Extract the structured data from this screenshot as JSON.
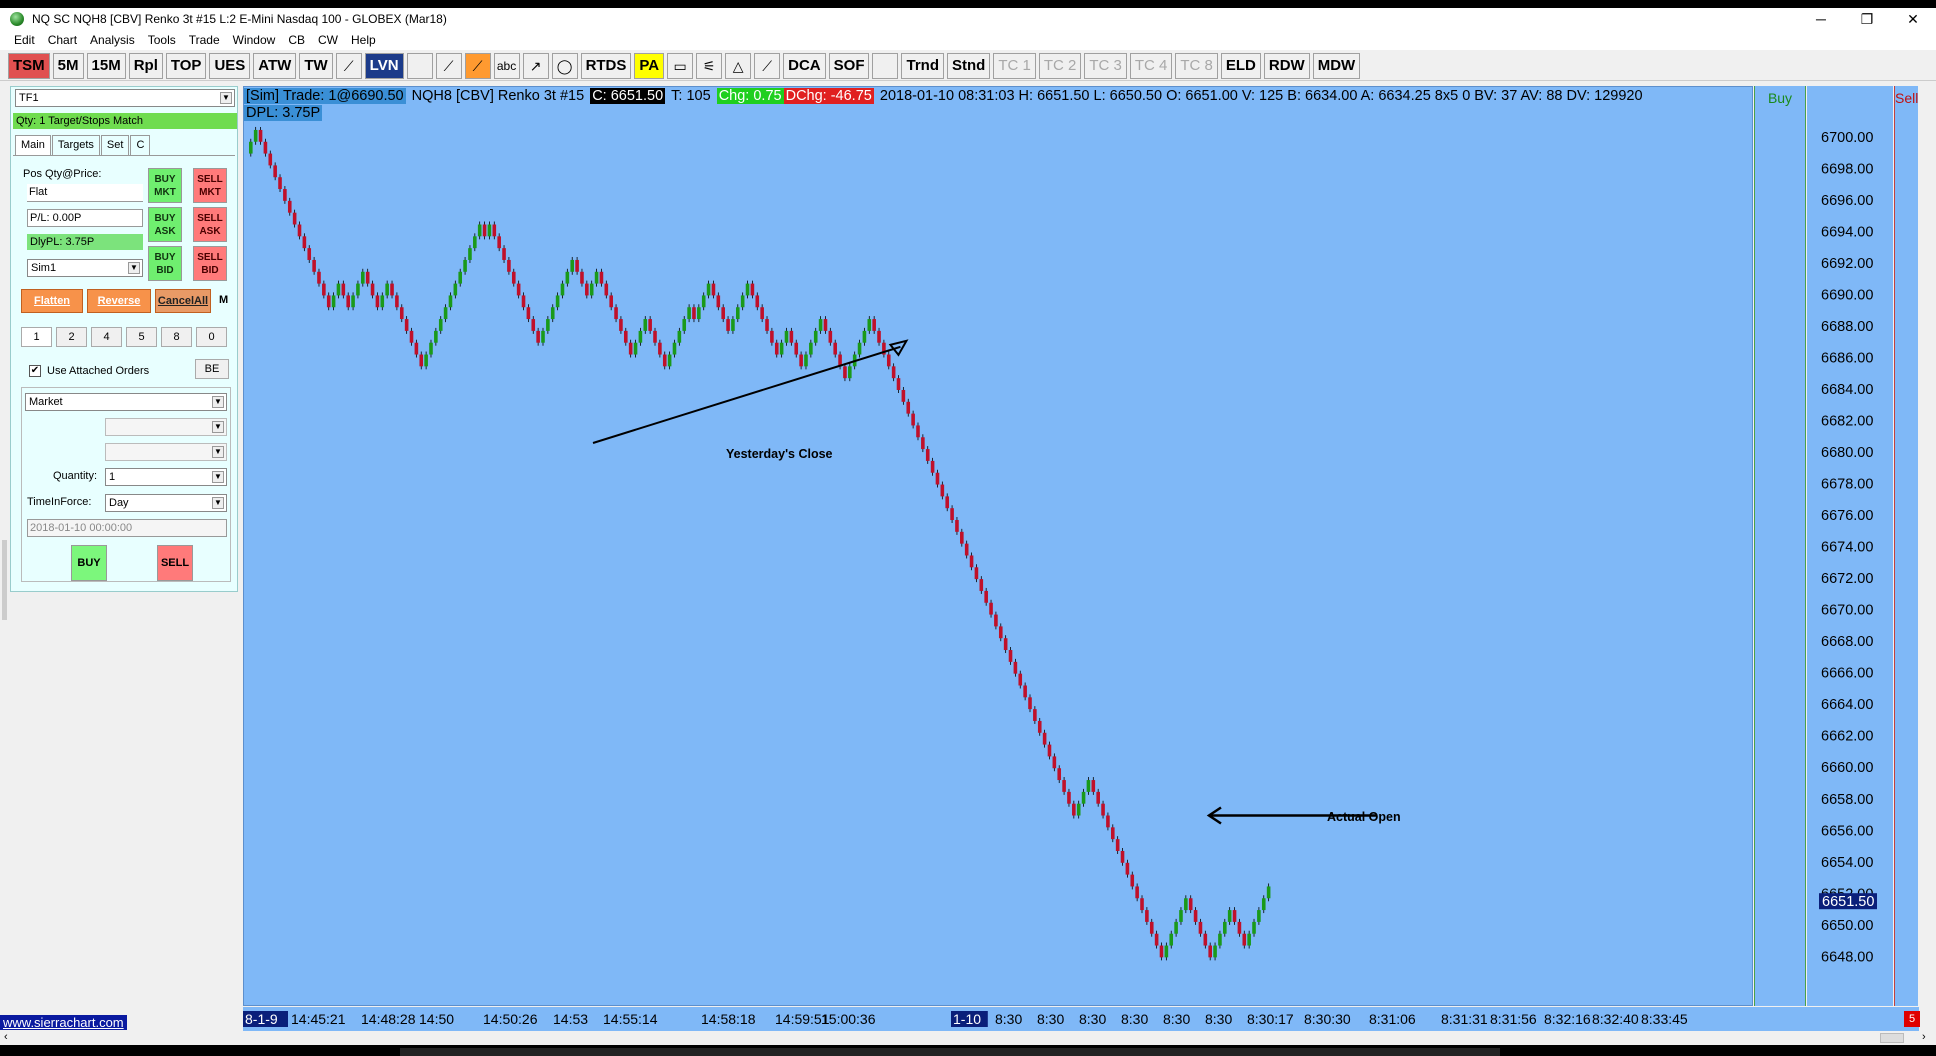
{
  "window": {
    "title": "NQ  SC NQH8 [CBV]  Renko 3t  #15  L:2  E-Mini Nasdaq 100 - GLOBEX (Mar18)",
    "minimize": "─",
    "maximize": "❐",
    "close": "✕"
  },
  "menu": [
    "Edit",
    "Chart",
    "Analysis",
    "Tools",
    "Trade",
    "Window",
    "CB",
    "CW",
    "Help"
  ],
  "toolbar": {
    "tsm": "TSM",
    "m5": "5M",
    "m15": "15M",
    "rpl": "Rpl",
    "top": "TOP",
    "ues": "UES",
    "atw": "ATW",
    "tw": "TW",
    "lvn": "LVN",
    "abc": "abc",
    "rtds": "RTDS",
    "pa": "PA",
    "dca": "DCA",
    "sof": "SOF",
    "trnd": "Trnd",
    "stnd": "Stnd",
    "tc1": "TC 1",
    "tc2": "TC 2",
    "tc3": "TC 3",
    "tc4": "TC 4",
    "tc8": "TC 8",
    "eld": "ELD",
    "rdw": "RDW",
    "mdw": "MDW"
  },
  "trade_panel": {
    "account_select": "TF1",
    "qty_status": "Qty: 1 Target/Stops Match",
    "tabs": [
      "Main",
      "Targets",
      "Set",
      "C"
    ],
    "pos_label": "Pos Qty@Price:",
    "pos_value": "Flat",
    "pl_value": "P/L: 0.00P",
    "dlypl_value": "DlyPL: 3.75P",
    "sim_select": "Sim1",
    "buy_mkt": [
      "BUY",
      "MKT"
    ],
    "sell_mkt": [
      "SELL",
      "MKT"
    ],
    "buy_ask": [
      "BUY",
      "ASK"
    ],
    "sell_ask": [
      "SELL",
      "ASK"
    ],
    "buy_bid": [
      "BUY",
      "BID"
    ],
    "sell_bid": [
      "SELL",
      "BID"
    ],
    "flatten": "Flatten",
    "reverse": "Reverse",
    "cancel_all": "CancelAll",
    "m": "M",
    "quick_qty": [
      "1",
      "2",
      "4",
      "5",
      "8",
      "0"
    ],
    "use_attached": "Use Attached Orders",
    "be": "BE",
    "order_type": "Market",
    "quantity_label": "Quantity:",
    "quantity_value": "1",
    "tif_label": "TimeInForce:",
    "tif_value": "Day",
    "date_value": "2018-01-10  00:00:00",
    "buy": "BUY",
    "sell": "SELL"
  },
  "chart_header": {
    "sim": "[Sim]",
    "trade": "Trade: 1@6690.50",
    "symbol": "NQH8 [CBV]   Renko 3t   #15",
    "close": "C: 6651.50",
    "ticks": "T: 105",
    "chg": "Chg: 0.75",
    "dchg": "DChg: -46.75",
    "stats": "2018-01-10 08:31:03  H: 6651.50  L: 6650.50  O: 6651.00  V: 125  B: 6634.00  A: 6634.25  8x5  0  BV: 37  AV: 88  DV: 129920",
    "dpl": "DPL: 3.75P",
    "buy_col": "Buy",
    "sell_col": "Sell"
  },
  "colors": {
    "chart_bg": "#7fb8f7",
    "up_bar": "#1a9a1a",
    "down_bar": "#c0102a",
    "price_box": "#0a1f7a"
  },
  "chart_data": {
    "type": "renko",
    "brick_size": 0.75,
    "y_ticks": [
      "6700.00",
      "6698.00",
      "6696.00",
      "6694.00",
      "6692.00",
      "6690.00",
      "6688.00",
      "6686.00",
      "6684.00",
      "6682.00",
      "6680.00",
      "6678.00",
      "6676.00",
      "6674.00",
      "6672.00",
      "6670.00",
      "6668.00",
      "6666.00",
      "6664.00",
      "6662.00",
      "6660.00",
      "6658.00",
      "6656.00",
      "6654.00",
      "6652.00",
      "6650.00",
      "6648.00"
    ],
    "ylim": [
      6646.5,
      6700.75
    ],
    "current_price": "6651.50",
    "x_ticks": [
      "8-1-9",
      "14:45:21",
      "14:48:28",
      "14:50",
      "14:50:26",
      "14:53",
      "14:55:14",
      "14:58:18",
      "14:59:51",
      "15:00:36",
      "1-10",
      "8:30",
      "8:30",
      "8:30",
      "8:30",
      "8:30",
      "8:30",
      "8:30:17",
      "8:30:30",
      "8:31:06",
      "8:31:31",
      "8:31:56",
      "8:32:16",
      "8:32:40",
      "8:33:45"
    ],
    "bricks": [
      6699.75,
      6700.5,
      6699.75,
      6699.0,
      6698.25,
      6697.5,
      6696.75,
      6696.0,
      6695.25,
      6694.5,
      6693.75,
      6693.0,
      6692.25,
      6691.5,
      6690.75,
      6690.0,
      6689.25,
      6690.0,
      6690.75,
      6690.0,
      6689.25,
      6690.0,
      6690.75,
      6691.5,
      6690.75,
      6690.0,
      6689.25,
      6690.0,
      6690.75,
      6690.0,
      6689.25,
      6688.5,
      6687.75,
      6687.0,
      6686.25,
      6685.5,
      6686.25,
      6687.0,
      6687.75,
      6688.5,
      6689.25,
      6690.0,
      6690.75,
      6691.5,
      6692.25,
      6693.0,
      6693.75,
      6694.5,
      6693.75,
      6694.5,
      6693.75,
      6693.0,
      6692.25,
      6691.5,
      6690.75,
      6690.0,
      6689.25,
      6688.5,
      6687.75,
      6687.0,
      6687.75,
      6688.5,
      6689.25,
      6690.0,
      6690.75,
      6691.5,
      6692.25,
      6691.5,
      6690.75,
      6690.0,
      6690.75,
      6691.5,
      6690.75,
      6690.0,
      6689.25,
      6688.5,
      6687.75,
      6687.0,
      6686.25,
      6687.0,
      6687.75,
      6688.5,
      6687.75,
      6687.0,
      6686.25,
      6685.5,
      6686.25,
      6687.0,
      6687.75,
      6688.5,
      6689.25,
      6688.5,
      6689.25,
      6690.0,
      6690.75,
      6690.0,
      6689.25,
      6688.5,
      6687.75,
      6688.5,
      6689.25,
      6690.0,
      6690.75,
      6690.0,
      6689.25,
      6688.5,
      6687.75,
      6687.0,
      6686.25,
      6687.0,
      6687.75,
      6687.0,
      6686.25,
      6685.5,
      6686.25,
      6687.0,
      6687.75,
      6688.5,
      6687.75,
      6687.0,
      6686.25,
      6685.5,
      6684.75,
      6685.5,
      6686.25,
      6687.0,
      6687.75,
      6688.5,
      6687.75,
      6687.0,
      6686.25,
      6685.5,
      6684.75,
      6684.0,
      6683.25,
      6682.5,
      6681.75,
      6681.0,
      6680.25,
      6679.5,
      6678.75,
      6678.0,
      6677.25,
      6676.5,
      6675.75,
      6675.0,
      6674.25,
      6673.5,
      6672.75,
      6672.0,
      6671.25,
      6670.5,
      6669.75,
      6669.0,
      6668.25,
      6667.5,
      6666.75,
      6666.0,
      6665.25,
      6664.5,
      6663.75,
      6663.0,
      6662.25,
      6661.5,
      6660.75,
      6660.0,
      6659.25,
      6658.5,
      6657.75,
      6657.0,
      6657.75,
      6658.5,
      6659.25,
      6658.5,
      6657.75,
      6657.0,
      6656.25,
      6655.5,
      6654.75,
      6654.0,
      6653.25,
      6652.5,
      6651.75,
      6651.0,
      6650.25,
      6649.5,
      6648.75,
      6648.0,
      6648.75,
      6649.5,
      6650.25,
      6651.0,
      6651.75,
      6651.0,
      6650.25,
      6649.5,
      6648.75,
      6648.0,
      6648.75,
      6649.5,
      6650.25,
      6651.0,
      6650.25,
      6649.5,
      6648.75,
      6649.5,
      6650.25,
      6651.0,
      6651.75,
      6652.5
    ],
    "annotations": [
      {
        "text": "Yesterday's Close",
        "price": 6687.5
      },
      {
        "text": "Actual Open",
        "price": 6657.0
      }
    ]
  },
  "footer": {
    "site": "www.sierrachart.com",
    "indicator": "5"
  }
}
